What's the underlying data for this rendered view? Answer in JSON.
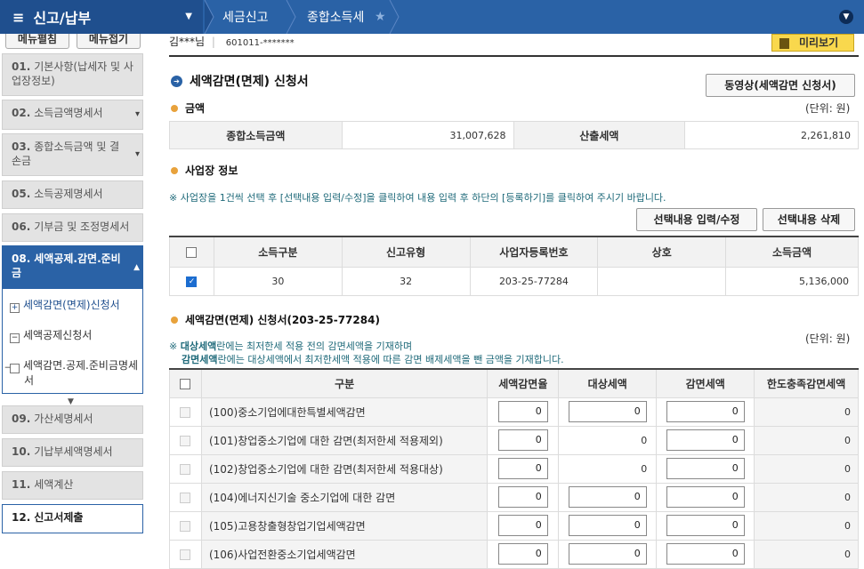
{
  "topbar": {
    "menu_title": "신고/납부",
    "crumbs": [
      "세금신고",
      "종합소득세"
    ]
  },
  "sidebar": {
    "open_all": "메뉴펼침",
    "close_all": "메뉴접기",
    "items": [
      {
        "num": "01.",
        "label": "기본사항(납세자 및 사업장정보)"
      },
      {
        "num": "02.",
        "label": "소득금액명세서"
      },
      {
        "num": "03.",
        "label": "종합소득금액 및 결손금"
      },
      {
        "num": "05.",
        "label": "소득공제명세서"
      },
      {
        "num": "06.",
        "label": "기부금 및 조정명세서"
      },
      {
        "num": "08.",
        "label": "세액공제.감면.준비금"
      },
      {
        "num": "09.",
        "label": "가산세명세서"
      },
      {
        "num": "10.",
        "label": "기납부세액명세서"
      },
      {
        "num": "11.",
        "label": "세액계산"
      },
      {
        "num": "12.",
        "label": "신고서제출"
      }
    ],
    "sub_items": [
      "세액감면(면제)신청서",
      "세액공제신청서",
      "세액감면.공제.준비금명세서"
    ]
  },
  "user": {
    "name": "김***님",
    "id": "601011-*******"
  },
  "preview_button": "미리보기",
  "page_title": "세액감면(면제) 신청서",
  "video_button": "동영상(세액감면 신청서)",
  "amount": {
    "heading": "금액",
    "unit": "(단위: 원)",
    "income_label": "종합소득금액",
    "income_value": "31,007,628",
    "tax_label": "산출세액",
    "tax_value": "2,261,810"
  },
  "biz": {
    "heading": "사업장 정보",
    "note": "※ 사업장을 1건씩 선택 후 [선택내용 입력/수정]을 클릭하여 내용 입력 후 하단의 [등록하기]를 클릭하여 주시기 바랍니다.",
    "edit_button": "선택내용 입력/수정",
    "delete_button": "선택내용 삭제",
    "headers": [
      "소득구분",
      "신고유형",
      "사업자등록번호",
      "상호",
      "소득금액"
    ],
    "row": {
      "income_type": "30",
      "report_type": "32",
      "reg_no": "203-25-77284",
      "name": "",
      "amount": "5,136,000"
    }
  },
  "deduction": {
    "heading": "세액감면(면제) 신청서(203-25-77284)",
    "note1_bold": "대상세액",
    "note1": "란에는 최저한세 적용 전의 감면세액을 기재하며",
    "note2_bold": "감면세액",
    "note2": "란에는 대상세액에서 최저한세액 적용에 따른 감면 배제세액을 뺀 금액을 기재합니다.",
    "note_prefix": "※",
    "unit": "(단위: 원)",
    "headers": [
      "구분",
      "세액감면율",
      "대상세액",
      "감면세액",
      "한도충족감면세액"
    ],
    "rows": [
      {
        "label": "(100)중소기업에대한특별세액감면",
        "rate": "0",
        "target": "0",
        "target_input": true,
        "reduce": "0",
        "limit": "0"
      },
      {
        "label": "(101)창업중소기업에 대한 감면(최저한세 적용제외)",
        "rate": "0",
        "target": "0",
        "target_input": false,
        "reduce": "0",
        "limit": "0"
      },
      {
        "label": "(102)창업중소기업에 대한 감면(최저한세 적용대상)",
        "rate": "0",
        "target": "0",
        "target_input": false,
        "reduce": "0",
        "limit": "0"
      },
      {
        "label": "(104)에너지신기술 중소기업에 대한 감면",
        "rate": "0",
        "target": "0",
        "target_input": true,
        "reduce": "0",
        "limit": "0"
      },
      {
        "label": "(105)고용창출형창업기업세액감면",
        "rate": "0",
        "target": "0",
        "target_input": true,
        "reduce": "0",
        "limit": "0"
      },
      {
        "label": "(106)사업전환중소기업세액감면",
        "rate": "0",
        "target": "0",
        "target_input": true,
        "reduce": "0",
        "limit": "0"
      }
    ]
  }
}
